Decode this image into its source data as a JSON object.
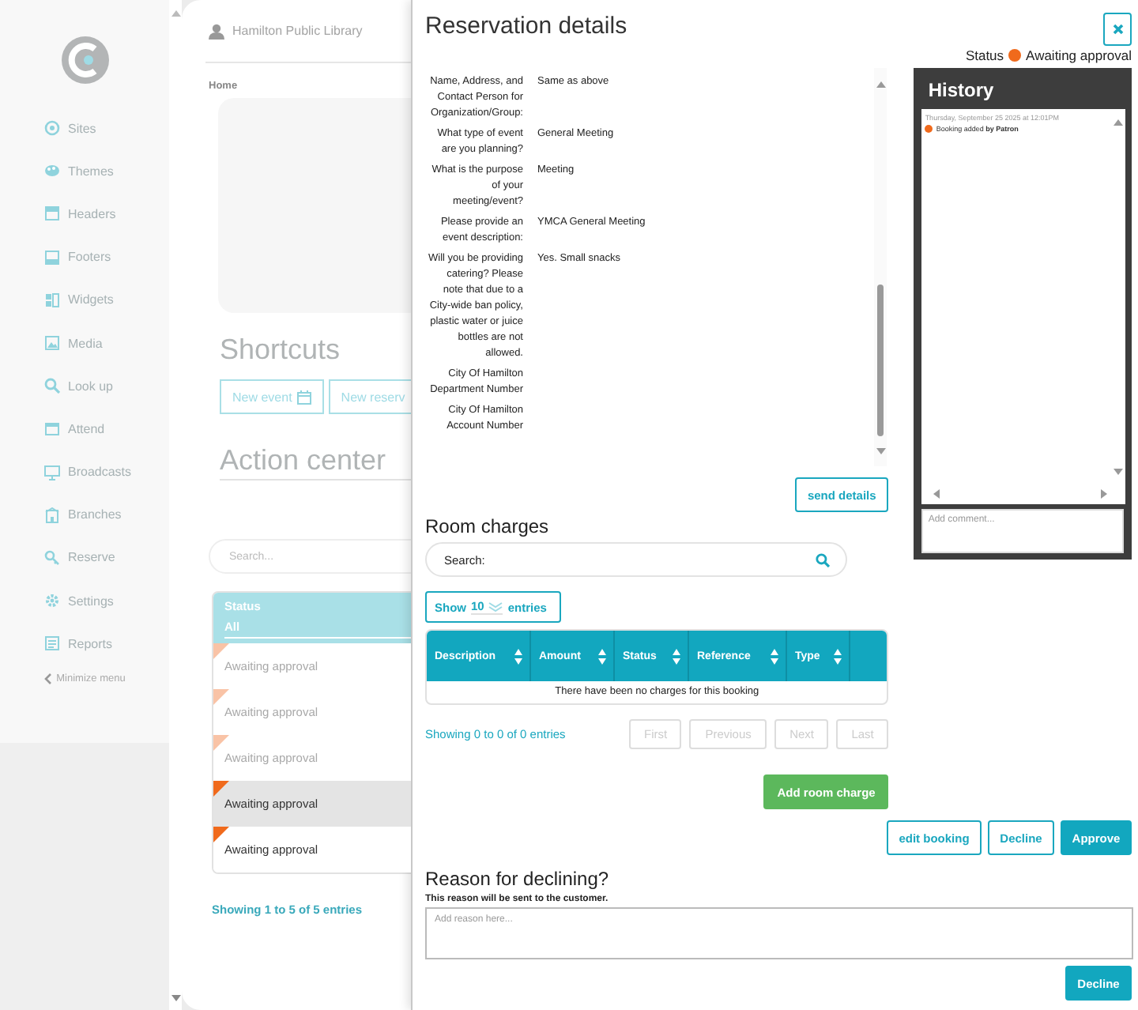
{
  "sidebar": {
    "items": [
      {
        "label": "Sites"
      },
      {
        "label": "Themes"
      },
      {
        "label": "Headers"
      },
      {
        "label": "Footers"
      },
      {
        "label": "Widgets"
      },
      {
        "label": "Media"
      },
      {
        "label": "Look up"
      },
      {
        "label": "Attend"
      },
      {
        "label": "Broadcasts"
      },
      {
        "label": "Branches"
      },
      {
        "label": "Reserve"
      },
      {
        "label": "Settings"
      },
      {
        "label": "Reports"
      }
    ],
    "minimize": "Minimize menu"
  },
  "header": {
    "library": "Hamilton Public Library"
  },
  "breadcrumb": "Home",
  "shortcuts": {
    "title": "Shortcuts",
    "buttons": [
      "New event",
      "New reserv"
    ]
  },
  "action_center": {
    "title": "Action center",
    "search": {
      "placeholder": "Search..."
    },
    "column": "Status",
    "filter": "All",
    "rows": [
      {
        "status": "Awaiting approval",
        "color": "#f9c3a6",
        "dimmed": true,
        "shaded": false
      },
      {
        "status": "Awaiting approval",
        "color": "#f9c3a6",
        "dimmed": true,
        "shaded": false
      },
      {
        "status": "Awaiting approval",
        "color": "#f9c3a6",
        "dimmed": true,
        "shaded": false
      },
      {
        "status": "Awaiting approval",
        "color": "#f06a1c",
        "dimmed": false,
        "shaded": true
      },
      {
        "status": "Awaiting approval",
        "color": "#f06a1c",
        "dimmed": false,
        "shaded": false
      }
    ],
    "info": "Showing 1 to 5 of 5 entries"
  },
  "modal": {
    "title": "Reservation details",
    "status_label": "Status",
    "status": {
      "text": "Awaiting approval",
      "color": "#f06a1c"
    },
    "details": [
      {
        "label": "Name, Address, and Contact Person for Organization/Group:",
        "value": "Same as above"
      },
      {
        "label": "What type of event are you planning?",
        "value": "General Meeting"
      },
      {
        "label": "What is the purpose of your meeting/event?",
        "value": "Meeting"
      },
      {
        "label": "Please provide an event description:",
        "value": "YMCA General Meeting"
      },
      {
        "label": "Will you be providing catering? Please note that due to a City-wide ban policy, plastic water or juice bottles are not allowed.",
        "value": "Yes. Small snacks"
      },
      {
        "label": "City Of Hamilton Department Number"
      },
      {
        "label": "City Of Hamilton Account Number"
      }
    ],
    "send_button": "send details",
    "history": {
      "title": "History",
      "entries": [
        {
          "time": "Thursday, September 25 2025 at 12:01PM",
          "text": "Booking added **by Patron**",
          "color": "#f06a1c"
        }
      ],
      "comment": {
        "placeholder": "Add comment..."
      }
    },
    "room_charges": {
      "title": "Room charges",
      "search_label": "Search:",
      "length": {
        "prefix": "Show",
        "value": "10",
        "suffix": "entries"
      },
      "columns": [
        "Description",
        "Amount",
        "Status",
        "Reference",
        "Type"
      ],
      "empty": "There have been no charges for this booking",
      "info": "Showing 0 to 0 of 0 entries",
      "pager": [
        {
          "label": "First",
          "disabled": true
        },
        {
          "label": "Previous",
          "disabled": true
        },
        {
          "label": "Next",
          "disabled": true
        },
        {
          "label": "Last",
          "disabled": true
        }
      ],
      "add_button": "Add room charge"
    },
    "actions": [
      {
        "label": "edit booking",
        "kind": "outline"
      },
      {
        "label": "Decline",
        "kind": "outline"
      },
      {
        "label": "Approve",
        "kind": "solid"
      }
    ],
    "reason": {
      "title": "Reason for declining?",
      "hint": "This reason will be sent to the customer.",
      "placeholder": "Add reason here...",
      "button": "Decline"
    }
  }
}
